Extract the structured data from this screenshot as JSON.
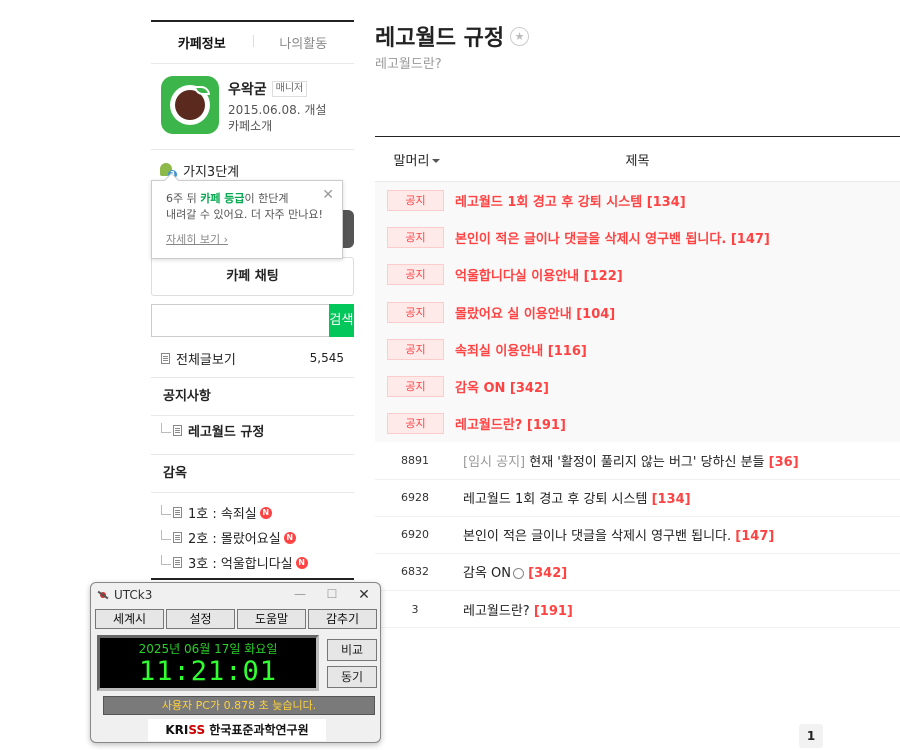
{
  "sidebar": {
    "tabs": [
      {
        "label": "카페정보",
        "active": true
      },
      {
        "label": "나의활동",
        "active": false
      }
    ],
    "cafe": {
      "name": "우왁굳",
      "role": "매니저",
      "founded": "2015.06.08. 개설",
      "intro_link": "카페소개"
    },
    "level": {
      "icon": "sprout-level-icon",
      "label": "가지3단계"
    },
    "tooltip": {
      "line1_pre": "6주 뒤 ",
      "line1_highlight": "카페 등급",
      "line1_post": "이 한단계",
      "line2": "내려갈 수 있어요. 더 자주 만나요!",
      "link": "자세히 보기"
    },
    "chat_button": "카페 채팅",
    "search": {
      "value": "",
      "button": "검색"
    },
    "all_posts": {
      "label": "전체글보기",
      "count": "5,545"
    },
    "notice_section": {
      "title": "공지사항",
      "items": [
        {
          "label": "레고월드 규정",
          "new": false
        }
      ]
    },
    "jail_section": {
      "title": "감옥",
      "items": [
        {
          "label": "1호 : 속죄실",
          "new": true
        },
        {
          "label": "2호 : 몰랐어요실",
          "new": true
        },
        {
          "label": "3호 : 억울합니다실",
          "new": true
        }
      ]
    },
    "new_badge": "N"
  },
  "board": {
    "title": "레고월드 규정",
    "subtitle": "레고월드란?",
    "columns": {
      "head": "말머리",
      "title": "제목"
    },
    "notice_tag": "공지",
    "notices": [
      {
        "title": "레고월드 1회 경고 후 강퇴 시스템",
        "comments": "[134]"
      },
      {
        "title": "본인이 적은 글이나 댓글을 삭제시 영구밴 됩니다.",
        "comments": "[147]"
      },
      {
        "title": "억울합니다실 이용안내",
        "comments": "[122]"
      },
      {
        "title": "몰랐어요 실 이용안내",
        "comments": "[104]"
      },
      {
        "title": "속죄실 이용안내",
        "comments": "[116]"
      },
      {
        "title": "감옥 ON",
        "comments": "[342]"
      },
      {
        "title": "레고월드란?",
        "comments": "[191]"
      }
    ],
    "posts": [
      {
        "num": "8891",
        "prefix": "[임시 공지]",
        "title": " 현재 '활정이 풀리지 않는 버그' 당하신 분들",
        "comments": "[36]",
        "emoticon": false
      },
      {
        "num": "6928",
        "prefix": "",
        "title": "레고월드 1회 경고 후 강퇴 시스템",
        "comments": "[134]",
        "emoticon": false
      },
      {
        "num": "6920",
        "prefix": "",
        "title": "본인이 적은 글이나 댓글을 삭제시 영구밴 됩니다.",
        "comments": "[147]",
        "emoticon": false
      },
      {
        "num": "6832",
        "prefix": "",
        "title": "감옥 ON",
        "comments": "[342]",
        "emoticon": true
      },
      {
        "num": "3",
        "prefix": "",
        "title": "레고월드란?",
        "comments": "[191]",
        "emoticon": false
      }
    ],
    "page": "1"
  },
  "utc": {
    "title": "UTCk3",
    "buttons": [
      "세계시",
      "설정",
      "도움말",
      "감추기"
    ],
    "date": "2025년 06월 17일 화요일",
    "time": "11:21:01",
    "side_buttons": [
      "비교",
      "동기"
    ],
    "status": "사용자 PC가 0.878 초 늦습니다.",
    "footer_brand_k": "KRI",
    "footer_brand_ss": "SS",
    "footer_org": "한국표준과학연구원",
    "colors": {
      "lcd_text": "#30ff30",
      "status_text": "#ffd23a"
    }
  },
  "colors": {
    "accent_green": "#03c75a",
    "notice_red": "#ff4343"
  }
}
